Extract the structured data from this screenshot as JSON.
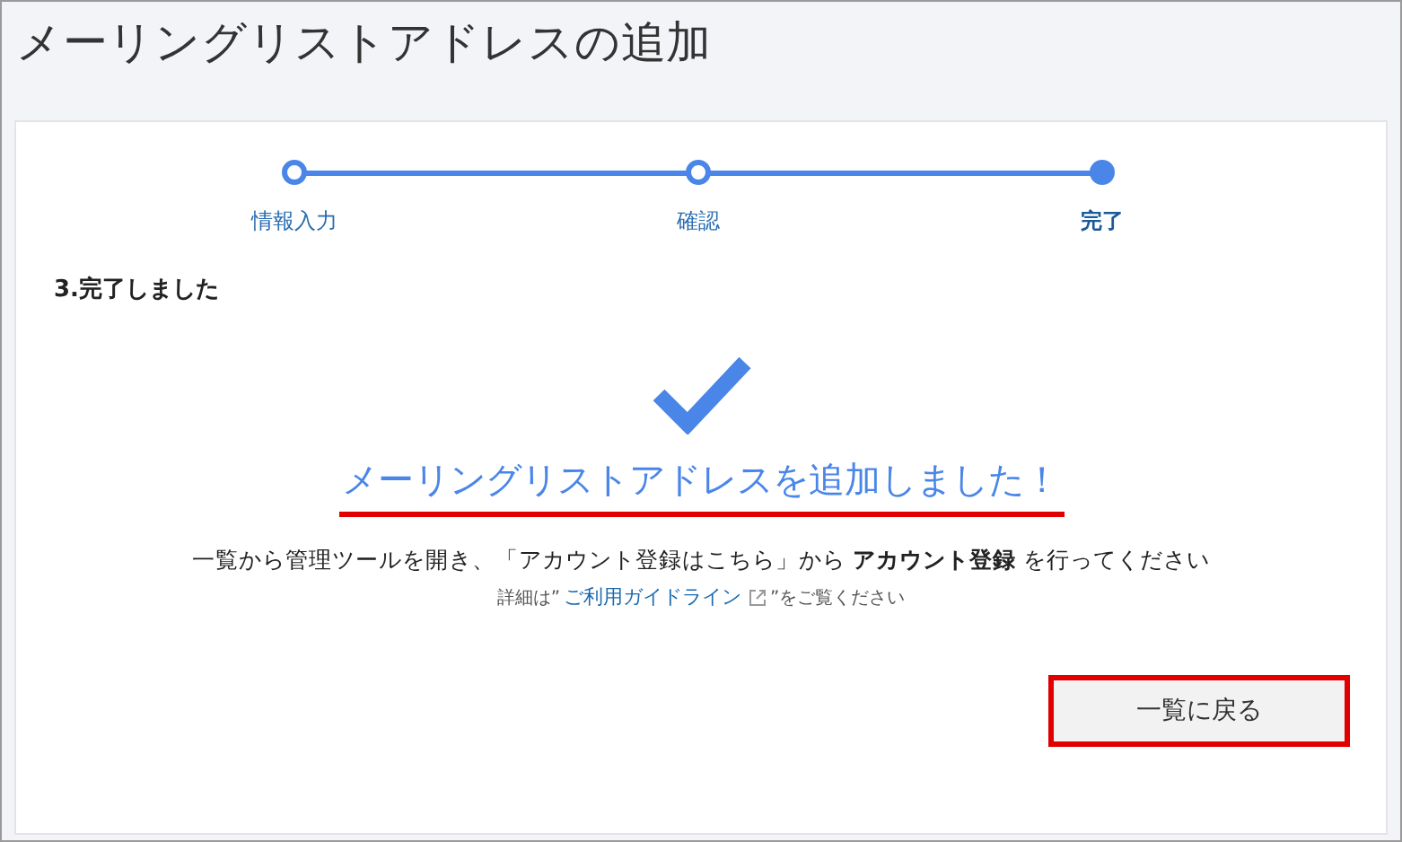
{
  "page": {
    "title": "メーリングリストアドレスの追加"
  },
  "steps": [
    {
      "label": "情報入力",
      "selected": false
    },
    {
      "label": "確認",
      "selected": false
    },
    {
      "label": "完了",
      "selected": true
    }
  ],
  "section_title": "3.完了しました",
  "message": "メーリングリストアドレスを追加しました！",
  "instruction": "一覧から管理ツールを開き、「アカウント登録はこちら」から **アカウント登録** を行ってください",
  "guide": {
    "prefix": "詳細は”",
    "link": "ご利用ガイドライン",
    "suffix": "”をご覧ください"
  },
  "back_button": "一覧に戻る"
}
